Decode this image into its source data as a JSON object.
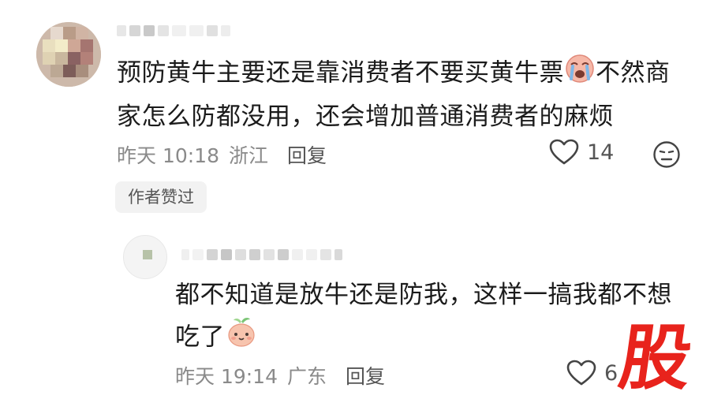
{
  "comment": {
    "text_line1": "预防黄牛主要还是靠消费者不要买黄牛票",
    "text_line1b": "不然商",
    "text_line2": "家怎么防都没用，还会增加普通消费者的麻烦",
    "time": "昨天 10:18",
    "location": "浙江",
    "reply_label": "回复",
    "likes": "14",
    "author_liked_label": "作者赞过",
    "emoji_icon": "crying-face-icon",
    "dislike_icon": "dislike-face-icon"
  },
  "reply": {
    "text_line1": "都不知道是放牛还是防我，这样一搞我都不想",
    "text_line2": "吃了",
    "time": "昨天 19:14",
    "location": "广东",
    "reply_label": "回复",
    "likes": "6",
    "emoji_icon": "peach-face-icon"
  },
  "watermark": {
    "text": "股",
    "color": "#e8231c"
  },
  "colors": {
    "text": "#1b1b1b",
    "meta": "#8a8a8a",
    "chip_bg": "#f2f2f2"
  }
}
